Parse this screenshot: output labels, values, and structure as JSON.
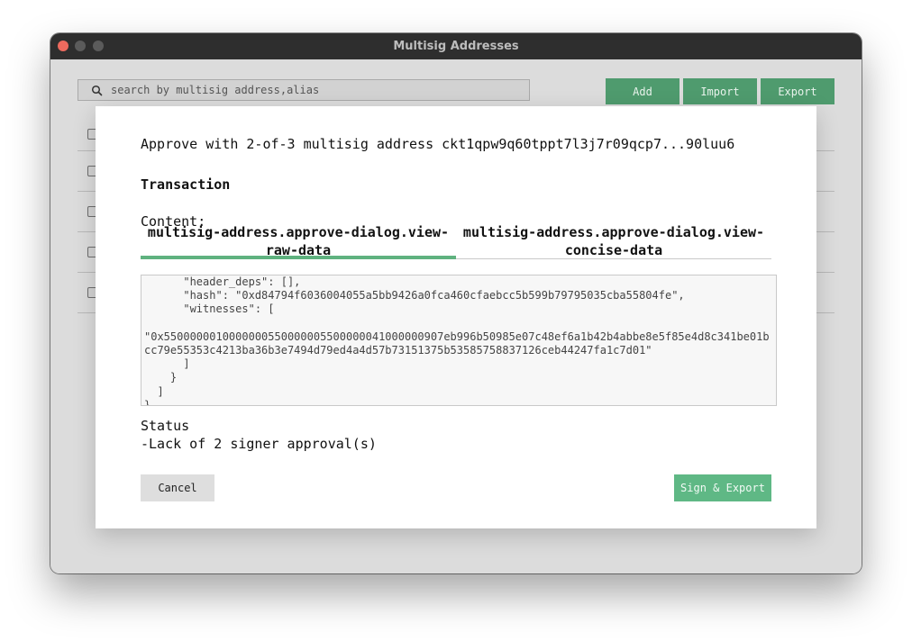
{
  "window": {
    "title": "Multisig Addresses"
  },
  "search": {
    "placeholder": "search by multisig address,alias"
  },
  "toolbar": {
    "add_label": "Add",
    "import_label": "Import",
    "export_label": "Export"
  },
  "dialog": {
    "title": "Approve with 2-of-3 multisig address ckt1qpw9q60tppt7l3j7r09qcp7...90luu6",
    "heading": "Transaction",
    "content_label": "Content:",
    "tabs": [
      {
        "label": "multisig-address.approve-dialog.view-raw-data",
        "active": true
      },
      {
        "label": "multisig-address.approve-dialog.view-concise-data",
        "active": false
      }
    ],
    "raw_data": "      \"header_deps\": [],\n      \"hash\": \"0xd84794f6036004055a5bb9426a0fca460cfaebcc5b599b79795035cba55804fe\",\n      \"witnesses\": [\n\n\"0x5500000010000000550000005500000041000000907eb996b50985e07c48ef6a1b42b4abbe8e5f85e4d8c341be01bcc79e55353c4213ba36b3e7494d79ed4a4d57b73151375b53585758837126ceb44247fa1c7d01\"\n      ]\n    }\n  ]\n}",
    "status_label": "Status",
    "status_value": "-Lack of 2 signer approval(s)",
    "cancel_label": "Cancel",
    "sign_label": "Sign & Export"
  },
  "colors": {
    "accent": "#5fb27f",
    "button_green": "#4f9b6e",
    "titlebar": "#2e2e2e"
  }
}
